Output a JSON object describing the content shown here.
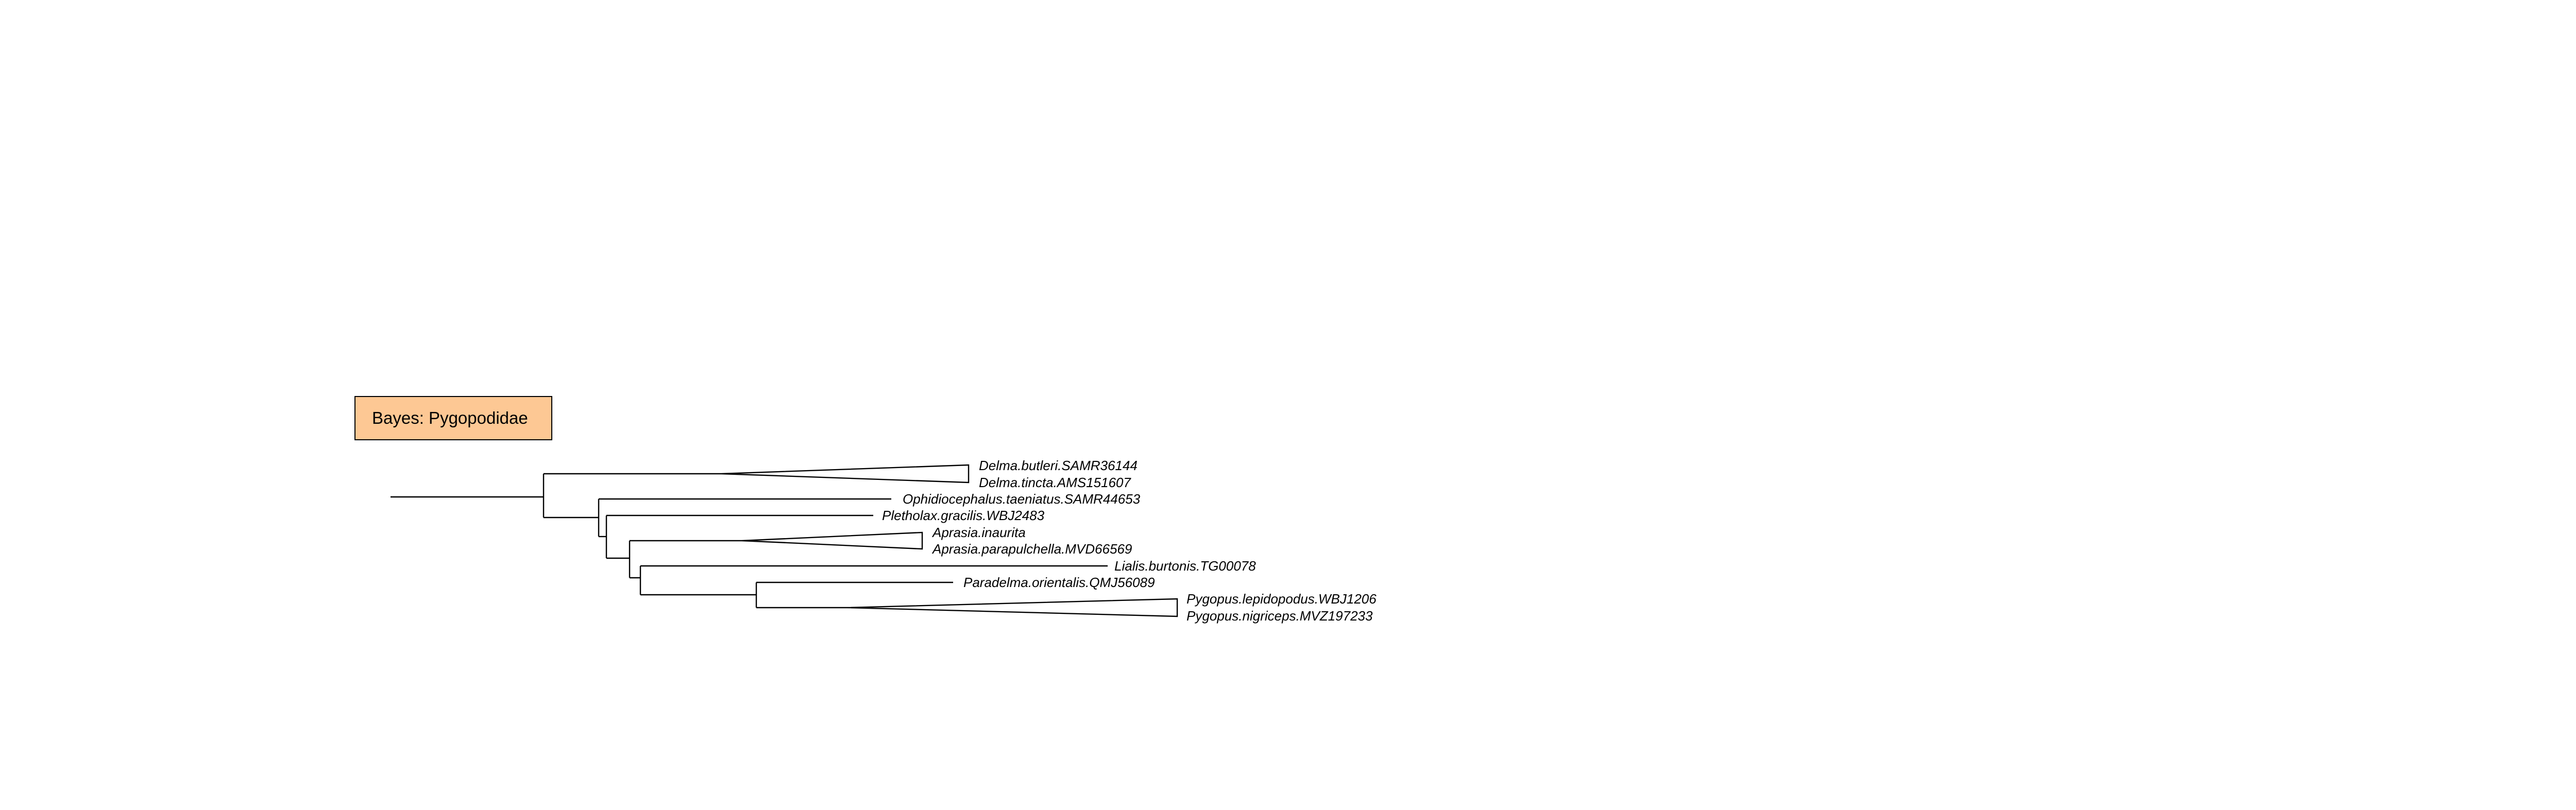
{
  "title": "Bayes: Pygopodidae",
  "colors": {
    "title_box_fill": "#fdc894",
    "line": "#000000",
    "right_edge_line": "#b8c9a3"
  },
  "tips": [
    "Delma.butleri.SAMR36144",
    "Delma.tincta.AMS151607",
    "Ophidiocephalus.taeniatus.SAMR44653",
    "Pletholax.gracilis.WBJ2483",
    "Aprasia.inaurita",
    "Aprasia.parapulchella.MVD66569",
    "Lialis.burtonis.TG00078",
    "Paradelma.orientalis.QMJ56089",
    "Pygopus.lepidopodus.WBJ1206",
    "Pygopus.nigriceps.MVZ197233"
  ],
  "collapsed_clades": [
    {
      "tips": [
        "Delma.butleri.SAMR36144",
        "Delma.tincta.AMS151607"
      ]
    },
    {
      "tips": [
        "Aprasia.inaurita",
        "Aprasia.parapulchella.MVD66569"
      ]
    },
    {
      "tips": [
        "Pygopus.lepidopodus.WBJ1206",
        "Pygopus.nigriceps.MVZ197233"
      ]
    }
  ]
}
